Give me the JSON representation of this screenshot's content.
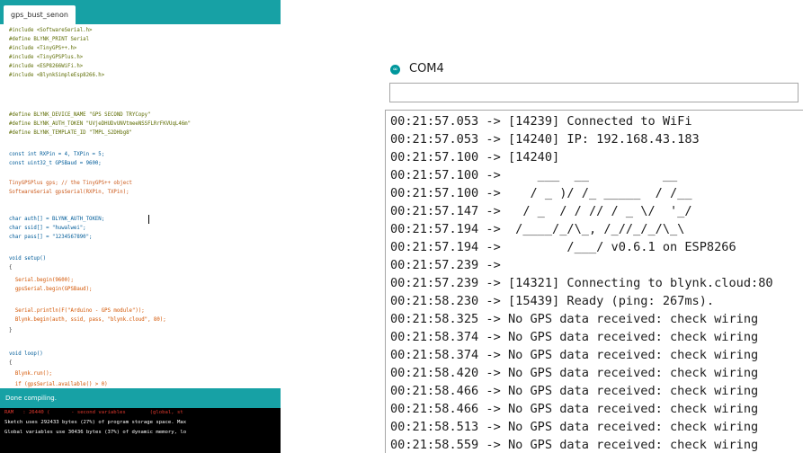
{
  "ide": {
    "tab_label": "gps_bust_senon",
    "code_lines": [
      "#include <SoftwareSerial.h>",
      "#define BLYNK_PRINT Serial",
      "#include <TinyGPS++.h>",
      "#include <TinyGPSPlus.h>",
      "#include <ESP8266WiFi.h>",
      "#include <BlynkSimpleEsp8266.h>",
      "#define BLYNK_DEVICE_NAME \"GPS SECOND TRYCopy\"",
      "#define BLYNK_AUTH_TOKEN \"UVjeDHUDvUNVtmeeNSSFLRrFKVUqL46m\"",
      "#define BLYNK_TEMPLATE_ID \"TMPL_S2DHbg8\"",
      "const int RXPin = 4, TXPin = 5;",
      "const uint32_t GPSBaud = 9600;",
      "TinyGPSPlus gps; // the TinyGPS++ object",
      "SoftwareSerial gpsSerial(RXPin, TXPin);",
      "char auth[] = BLYNK_AUTH_TOKEN;",
      "char ssid[] = \"huwalwei\";",
      "char pass[] = \"1234567890\";",
      "void setup()",
      "{",
      "  Serial.begin(9600);",
      "  gpsSerial.begin(GPSBaud);",
      "  Serial.println(F(\"Arduino - GPS module\"));",
      "  Blynk.begin(auth, ssid, pass, \"blynk.cloud\", 80);",
      "}",
      "void loop()",
      "{",
      "  Blynk.run();",
      "  if (gpsSerial.available() > 0)"
    ],
    "status_text": "Done compiling.",
    "console_lines": [
      "RAM   : 26440 (       - second variables        (global, st",
      "Sketch uses 292433 bytes (27%) of program storage space. Max",
      "Global variables use 30436 bytes (37%) of dynamic memory, lo"
    ],
    "colors": {
      "teal": "#17a1a5",
      "console_bg": "#000000"
    }
  },
  "serial_monitor": {
    "title": "COM4",
    "input_value": "",
    "lines": [
      "00:21:57.053 -> [14239] Connected to WiFi",
      "00:21:57.053 -> [14240] IP: 192.168.43.183",
      "00:21:57.100 -> [14240]",
      "00:21:57.100 ->     ___  __          __",
      "00:21:57.100 ->    / _ )/ /_ _____  / /__",
      "00:21:57.147 ->   / _  / / // / _ \\/  '_/",
      "00:21:57.194 ->  /____/_/\\_, /_//_/_/\\_\\",
      "00:21:57.194 ->         /___/ v0.6.1 on ESP8266",
      "00:21:57.239 ->",
      "00:21:57.239 -> [14321] Connecting to blynk.cloud:80",
      "00:21:58.230 -> [15439] Ready (ping: 267ms).",
      "00:21:58.325 -> No GPS data received: check wiring",
      "00:21:58.374 -> No GPS data received: check wiring",
      "00:21:58.374 -> No GPS data received: check wiring",
      "00:21:58.420 -> No GPS data received: check wiring",
      "00:21:58.466 -> No GPS data received: check wiring",
      "00:21:58.466 -> No GPS data received: check wiring",
      "00:21:58.513 -> No GPS data received: check wiring",
      "00:21:58.559 -> No GPS data received: check wiring"
    ]
  }
}
